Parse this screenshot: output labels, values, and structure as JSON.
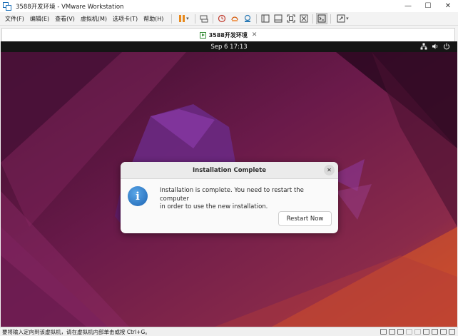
{
  "window": {
    "title": "3588开发环境 - VMware Workstation",
    "controls": {
      "minimize": "—",
      "maximize": "☐",
      "close": "✕"
    }
  },
  "menubar": {
    "items": [
      {
        "label": "文件(F)",
        "name": "menu-file"
      },
      {
        "label": "编辑(E)",
        "name": "menu-edit"
      },
      {
        "label": "查看(V)",
        "name": "menu-view"
      },
      {
        "label": "虚拟机(M)",
        "name": "menu-vm"
      },
      {
        "label": "选项卡(T)",
        "name": "menu-tabs"
      },
      {
        "label": "帮助(H)",
        "name": "menu-help"
      }
    ]
  },
  "toolbar": {
    "icons": [
      "pause-icon",
      "send-ctrl-alt-del-icon",
      "snapshot-icon",
      "revert-snapshot-icon",
      "snapshot-manager-icon",
      "library-icon",
      "thumbnail-bar-icon",
      "full-screen-icon",
      "unity-icon",
      "console-view-icon",
      "stretch-guest-icon"
    ],
    "accent": "#e8891b"
  },
  "tab": {
    "label": "3588开发环境",
    "close": "✕"
  },
  "vm": {
    "clock": "Sep 6  17:13",
    "tray": [
      "network-icon",
      "volume-icon",
      "power-icon"
    ]
  },
  "dialog": {
    "title": "Installation Complete",
    "close": "✕",
    "info_glyph": "i",
    "message_line1": "Installation is complete. You need to restart the computer",
    "message_line2": "in order to use the new installation.",
    "button": "Restart Now"
  },
  "statusbar": {
    "text": "要将输入定向到该虚拟机，请在虚拟机内部单击或按 Ctrl+G。",
    "icons": [
      "hard-disk-icon",
      "cd-dvd-icon",
      "network-adapter-icon",
      "usb-icon",
      "printer-icon",
      "sound-icon",
      "display-icon",
      "message-log-icon",
      "stretch-icon"
    ]
  },
  "colors": {
    "wallpaper_base": "#5c1744",
    "wallpaper_accent": "#e2531f",
    "info_blue": "#1d64b3"
  }
}
